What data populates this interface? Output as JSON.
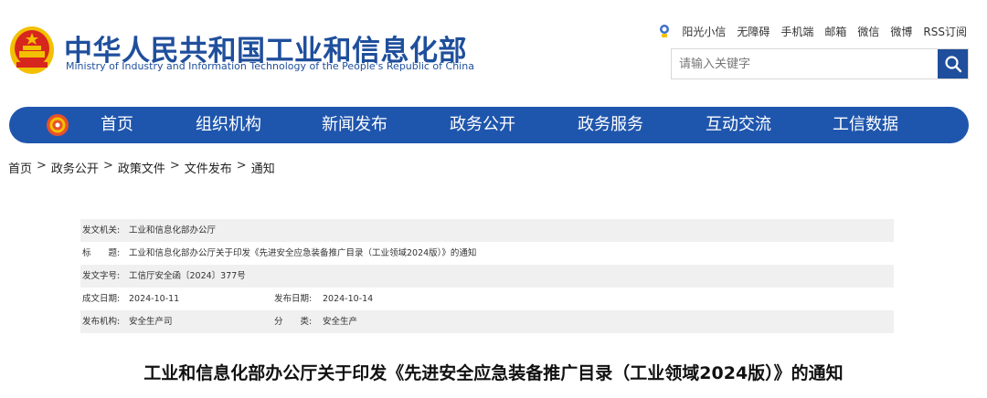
{
  "header": {
    "title_cn": "中华人民共和国工业和信息化部",
    "title_en": "Ministry of Industry and Information Technology of the People's Republic of China"
  },
  "toplinks": [
    "阳光小信",
    "无障碍",
    "手机端",
    "邮箱",
    "微信",
    "微博",
    "RSS订阅"
  ],
  "search": {
    "placeholder": "请输入关键字"
  },
  "nav": [
    "首页",
    "组织机构",
    "新闻发布",
    "政务公开",
    "政务服务",
    "互动交流",
    "工信数据"
  ],
  "breadcrumb": [
    "首页",
    "政务公开",
    "政策文件",
    "文件发布",
    "通知"
  ],
  "meta": {
    "issuer_label": "发文机关:",
    "issuer": "工业和信息化部办公厅",
    "title_label": "标　　题:",
    "title": "工业和信息化部办公厅关于印发《先进安全应急装备推广目录（工业领域2024版）》的通知",
    "doc_no_label": "发文字号:",
    "doc_no": "工信厅安全函〔2024〕377号",
    "date_label": "成文日期:",
    "date": "2024-10-11",
    "publish_label": "发布日期:",
    "publish": "2024-10-14",
    "org_label": "发布机构:",
    "org": "安全生产司",
    "category_label": "分　　类:",
    "category": "安全生产"
  },
  "article": {
    "title": "工业和信息化部办公厅关于印发《先进安全应急装备推广目录（工业领域2024版）》的通知"
  },
  "colors": {
    "brand_blue": "#1f56ad",
    "title_blue": "#1f4f9c",
    "emblem_red": "#d7261e",
    "emblem_gold": "#f3c000"
  }
}
